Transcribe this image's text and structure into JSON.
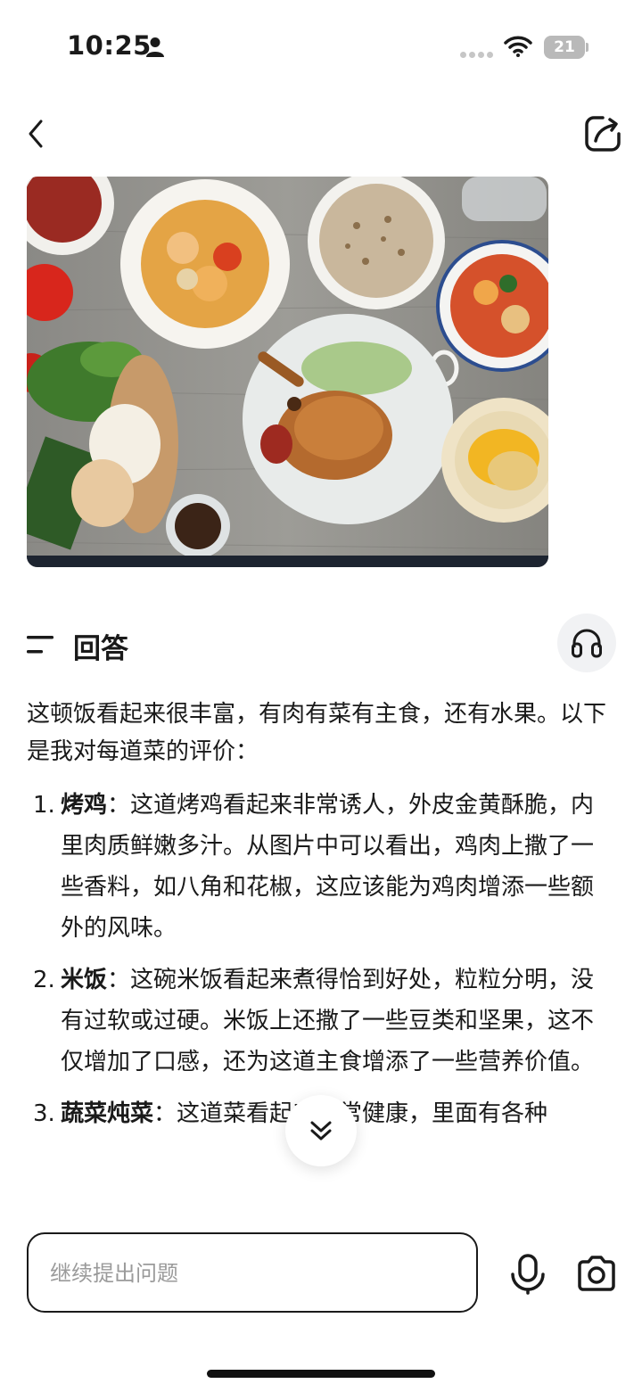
{
  "status_bar": {
    "time": "10:25",
    "battery": "21"
  },
  "answer": {
    "title": "回答",
    "intro": "这顿饭看起来很丰富，有肉有菜有主食，还有水果。以下是我对每道菜的评价：",
    "items": [
      {
        "num": "1.",
        "title": "烤鸡",
        "text": "：这道烤鸡看起来非常诱人，外皮金黄酥脆，内里肉质鲜嫩多汁。从图片中可以看出，鸡肉上撒了一些香料，如八角和花椒，这应该能为鸡肉增添一些额外的风味。"
      },
      {
        "num": "2.",
        "title": "米饭",
        "text": "：这碗米饭看起来煮得恰到好处，粒粒分明，没有过软或过硬。米饭上还撒了一些豆类和坚果，这不仅增加了口感，还为这道主食增添了一些营养价值。"
      },
      {
        "num": "3.",
        "title": "蔬菜炖菜",
        "text": "：这道菜看起来非常健康，里面有各种"
      }
    ]
  },
  "input": {
    "placeholder": "继续提出问题"
  },
  "icons": {
    "back": "chevron-left-icon",
    "share": "share-icon",
    "answer": "answer-lines-icon",
    "audio": "headphones-icon",
    "scroll": "double-chevron-down-icon",
    "mic": "microphone-icon",
    "camera": "camera-icon"
  }
}
